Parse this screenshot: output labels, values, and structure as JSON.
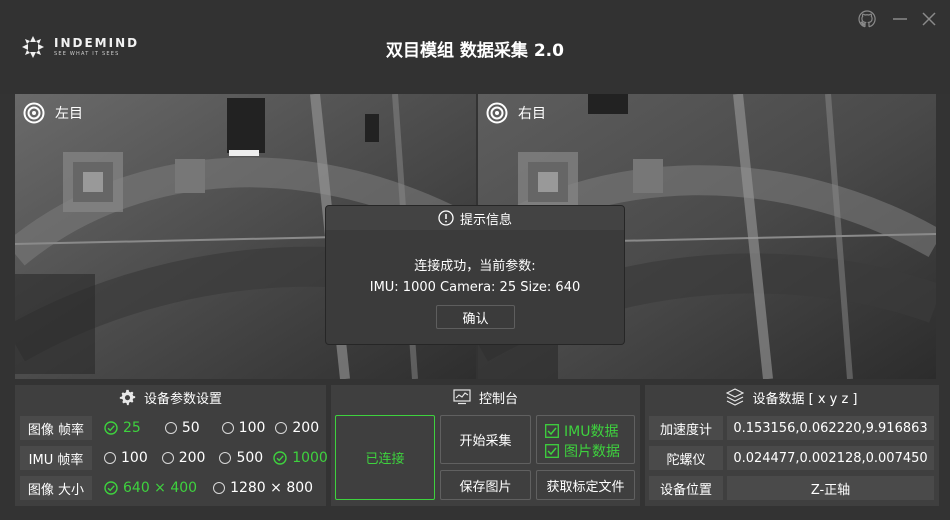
{
  "app": {
    "brand_name": "INDEMIND",
    "brand_tagline": "SEE WHAT IT SEES",
    "title": "双目模组 数据采集 2.0",
    "icons": [
      "github-icon",
      "minimize-icon",
      "close-icon"
    ]
  },
  "cameras": {
    "left_label": "左目",
    "right_label": "右目"
  },
  "dialog": {
    "title": "提示信息",
    "line1": "连接成功，当前参数:",
    "line2": "IMU: 1000 Camera: 25 Size: 640",
    "confirm_label": "确认"
  },
  "settings": {
    "title": "设备参数设置",
    "rows": [
      {
        "label": "图像 帧率",
        "options": [
          "25",
          "50",
          "100",
          "200"
        ],
        "selected": "25"
      },
      {
        "label": "IMU 帧率",
        "options": [
          "100",
          "200",
          "500",
          "1000"
        ],
        "selected": "1000"
      },
      {
        "label": "图像 大小",
        "options": [
          "640 × 400",
          "1280 × 800"
        ],
        "selected": "640 × 400"
      }
    ]
  },
  "console": {
    "title": "控制台",
    "connected_label": "已连接",
    "start_label": "开始采集",
    "save_image_label": "保存图片",
    "calib_label": "获取标定文件",
    "imu_data_label": "IMU数据",
    "image_data_label": "图片数据",
    "imu_data_checked": true,
    "image_data_checked": true
  },
  "device": {
    "title": "设备数据 [ x y z ]",
    "accel_label": "加速度计",
    "accel_value": "0.153156,0.062220,9.916863",
    "gyro_label": "陀螺仪",
    "gyro_value": "0.024477,0.002128,0.007450",
    "position_label": "设备位置",
    "position_value": "Z-正轴"
  },
  "colors": {
    "accent_green": "#3ed23e",
    "background": "#333333",
    "panel": "#3f3f3f"
  }
}
